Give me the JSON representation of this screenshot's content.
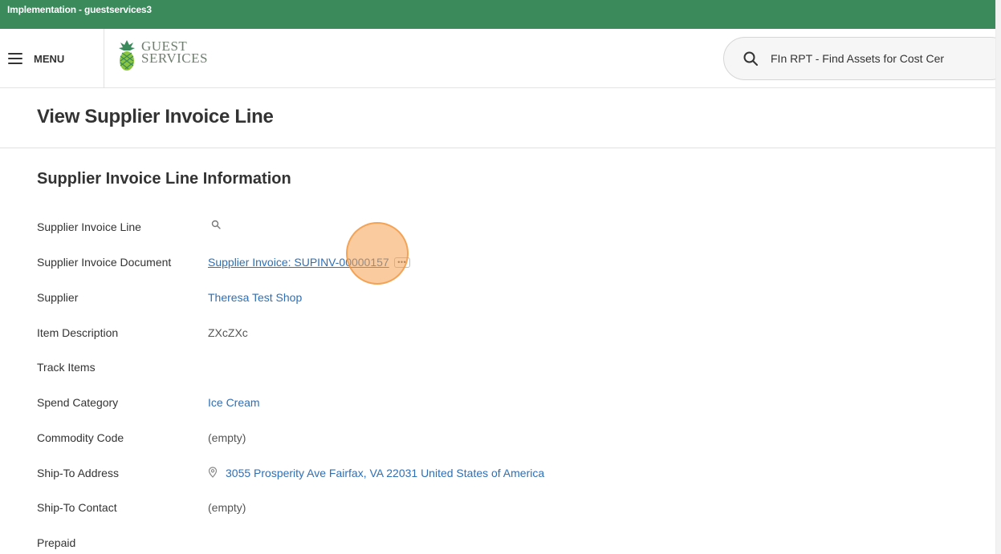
{
  "environment": {
    "label": "Implementation - guestservices3"
  },
  "header": {
    "menu_label": "MENU",
    "logo": {
      "line1": "GUEST",
      "line2": "SERVICES"
    },
    "search": {
      "query": "FIn RPT - Find Assets for Cost Cer"
    }
  },
  "page": {
    "title": "View Supplier Invoice Line"
  },
  "section": {
    "title": "Supplier Invoice Line Information"
  },
  "fields": {
    "supplier_invoice_line": {
      "label": "Supplier Invoice Line"
    },
    "supplier_invoice_document": {
      "label": "Supplier Invoice Document",
      "value": "Supplier Invoice: SUPINV-00000157"
    },
    "supplier": {
      "label": "Supplier",
      "value": "Theresa Test Shop"
    },
    "item_description": {
      "label": "Item Description",
      "value": "ZXcZXc"
    },
    "track_items": {
      "label": "Track Items",
      "value": ""
    },
    "spend_category": {
      "label": "Spend Category",
      "value": "Ice Cream"
    },
    "commodity_code": {
      "label": "Commodity Code",
      "value": "(empty)"
    },
    "ship_to_address": {
      "label": "Ship-To Address",
      "value": "3055 Prosperity Ave Fairfax, VA 22031 United States of America"
    },
    "ship_to_contact": {
      "label": "Ship-To Contact",
      "value": "(empty)"
    },
    "prepaid": {
      "label": "Prepaid",
      "value": ""
    }
  },
  "colors": {
    "environment_bar": "#3a8a5c",
    "link": "#2e6fb5",
    "click_marker": "#f5a050"
  },
  "icons": [
    "hamburger-icon",
    "pineapple-logo-icon",
    "search-icon",
    "magnifier-icon",
    "ellipsis-icon",
    "location-pin-icon"
  ]
}
